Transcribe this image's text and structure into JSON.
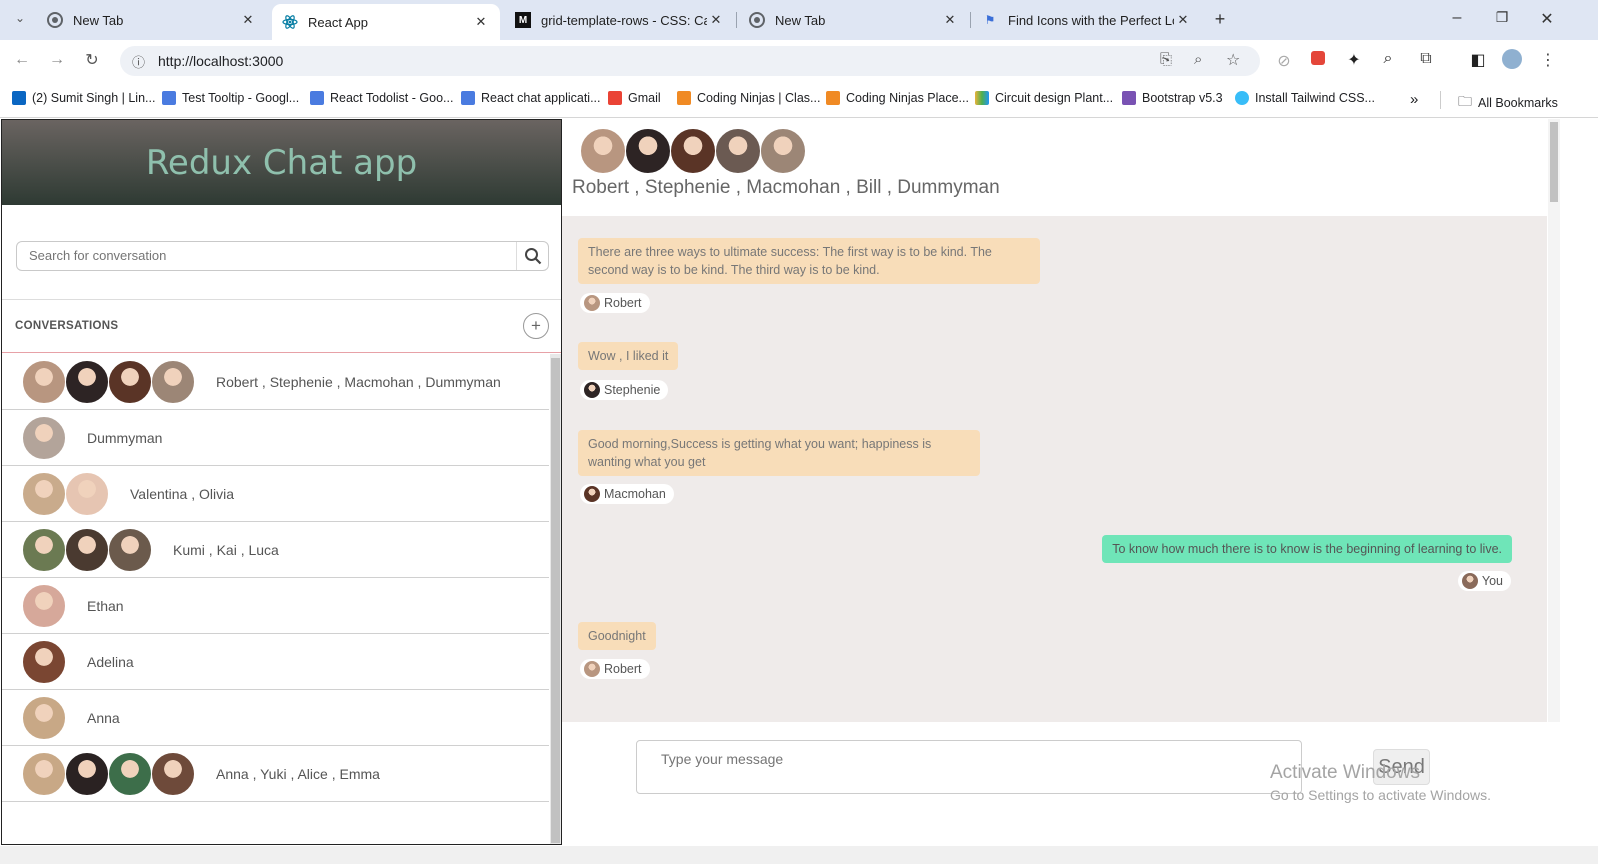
{
  "browser": {
    "tabs": [
      {
        "title": "New Tab",
        "active": false
      },
      {
        "title": "React App",
        "active": true
      },
      {
        "title": "grid-template-rows - CSS: Casca",
        "active": false
      },
      {
        "title": "New Tab",
        "active": false
      },
      {
        "title": "Find Icons with the Perfect Look",
        "active": false
      }
    ],
    "url": "http://localhost:3000",
    "bookmarks": [
      "(2) Sumit Singh | Lin...",
      "Test Tooltip - Googl...",
      "React Todolist - Goo...",
      "React chat applicati...",
      "Gmail",
      "Coding Ninjas | Clas...",
      "Coding Ninjas Place...",
      "Circuit design Plant...",
      "Bootstrap v5.3",
      "Install Tailwind CSS..."
    ],
    "all_bookmarks": "All Bookmarks"
  },
  "app": {
    "title": "Redux Chat app",
    "search_placeholder": "Search for conversation",
    "conversations_label": "CONVERSATIONS",
    "add_symbol": "+",
    "conversations": [
      {
        "name": "Robert , Stephenie , Macmohan , Dummyman",
        "avatars": [
          "#b89680",
          "#2d2424",
          "#5a3426",
          "#9c8676"
        ]
      },
      {
        "name": "Dummyman",
        "avatars": [
          "#b3a49a"
        ]
      },
      {
        "name": "Valentina , Olivia",
        "avatars": [
          "#c9ab8c",
          "#e6c5b2"
        ]
      },
      {
        "name": "Kumi , Kai , Luca",
        "avatars": [
          "#6b7a52",
          "#4a3a30",
          "#6b5a4c"
        ]
      },
      {
        "name": "Ethan",
        "avatars": [
          "#d6a89a"
        ]
      },
      {
        "name": "Adelina",
        "avatars": [
          "#7a4632"
        ]
      },
      {
        "name": "Anna",
        "avatars": [
          "#c8a886"
        ]
      },
      {
        "name": "Anna , Yuki , Alice , Emma",
        "avatars": [
          "#c8a886",
          "#2a2222",
          "#3d6e4a",
          "#6e4a3a"
        ]
      }
    ]
  },
  "chat": {
    "header_avatars": [
      "#b89680",
      "#2d2424",
      "#5a3426",
      "#6b5a52",
      "#9c8676"
    ],
    "participants": "Robert , Stephenie , Macmohan , Bill , Dummyman",
    "messages": [
      {
        "text": "There are three ways to ultimate success: The first way is to be kind. The second way is to be kind. The third way is to be kind.",
        "sender": "Robert",
        "avatar": "#b89680",
        "mine": false
      },
      {
        "text": "Wow , I liked it",
        "sender": "Stephenie",
        "avatar": "#2d2424",
        "mine": false
      },
      {
        "text": "Good morning,Success is getting what you want; happiness is wanting what you get",
        "sender": "Macmohan",
        "avatar": "#5a3426",
        "mine": false
      },
      {
        "text": "To know how much there is to know is the beginning of learning to live.",
        "sender": "You",
        "avatar": "#8a6a5a",
        "mine": true
      },
      {
        "text": "Goodnight",
        "sender": "Robert",
        "avatar": "#b89680",
        "mine": false
      }
    ],
    "input_placeholder": "Type your message",
    "send_label": "Send"
  },
  "watermark": {
    "title": "Activate Windows",
    "subtitle": "Go to Settings to activate Windows."
  }
}
